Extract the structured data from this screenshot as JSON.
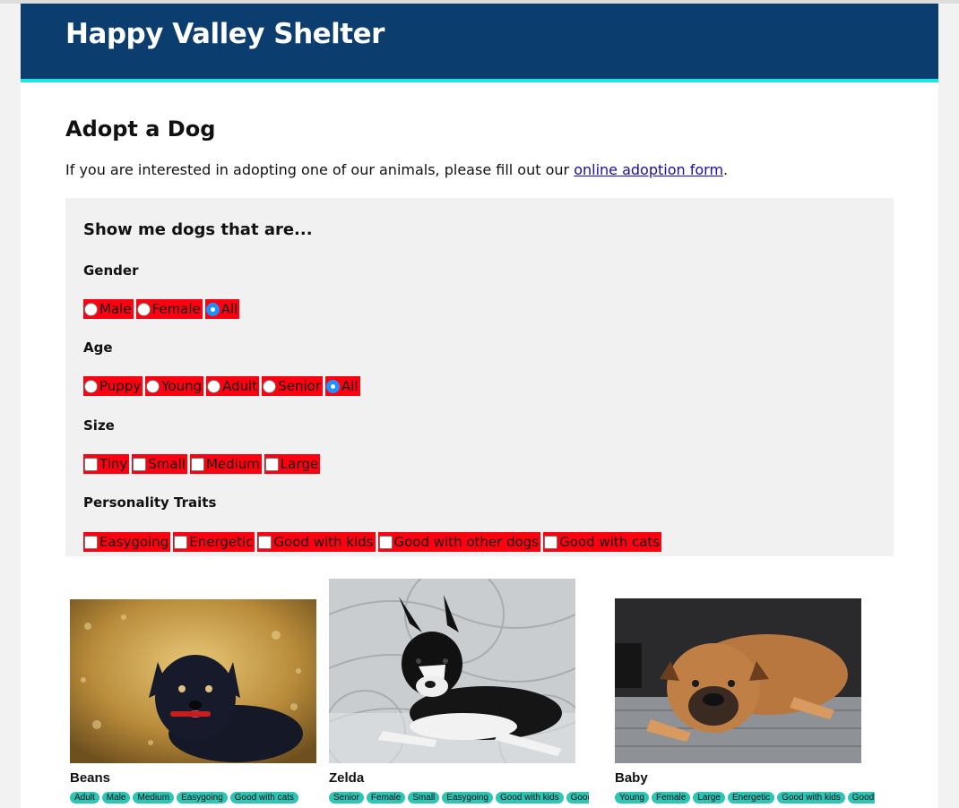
{
  "site": {
    "title": "Happy Valley Shelter"
  },
  "page": {
    "title": "Adopt a Dog",
    "intro_before": "If you are interested in adopting one of our animals, please fill out our ",
    "intro_link": "online adoption form",
    "intro_after": "."
  },
  "filters": {
    "title": "Show me dogs that are...",
    "gender": {
      "label": "Gender",
      "options": [
        "Male",
        "Female",
        "All"
      ],
      "selected": "All"
    },
    "age": {
      "label": "Age",
      "options": [
        "Puppy",
        "Young",
        "Adult",
        "Senior",
        "All"
      ],
      "selected": "All"
    },
    "size": {
      "label": "Size",
      "options": [
        "Tiny",
        "Small",
        "Medium",
        "Large"
      ]
    },
    "traits": {
      "label": "Personality Traits",
      "options": [
        "Easygoing",
        "Energetic",
        "Good with kids",
        "Good with other dogs",
        "Good with cats"
      ]
    }
  },
  "dogs": [
    {
      "name": "Beans",
      "tags": [
        "Adult",
        "Male",
        "Medium",
        "Easygoing",
        "Good with cats"
      ]
    },
    {
      "name": "Zelda",
      "tags": [
        "Senior",
        "Female",
        "Small",
        "Easygoing",
        "Good with kids",
        "Good"
      ]
    },
    {
      "name": "Baby",
      "tags": [
        "Young",
        "Female",
        "Large",
        "Energetic",
        "Good with kids",
        "Good"
      ]
    }
  ],
  "colors": {
    "header_bg": "#0b3d6f",
    "header_accent": "#1be6e6",
    "option_bg": "#ff0010",
    "tag_bg": "#2ec4b6",
    "link": "#1a0dab"
  }
}
